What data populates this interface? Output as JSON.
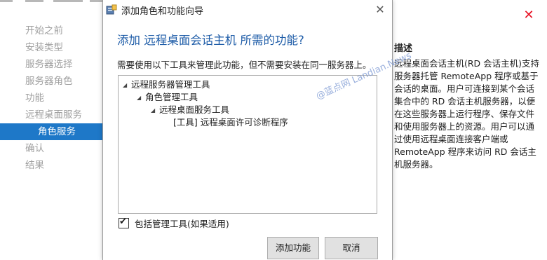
{
  "background_wizard": {
    "close_icon": "close-icon",
    "nav_items": [
      {
        "label": "开始之前"
      },
      {
        "label": "安装类型"
      },
      {
        "label": "服务器选择"
      },
      {
        "label": "服务器角色"
      },
      {
        "label": "功能"
      },
      {
        "label": "远程桌面服务"
      },
      {
        "label": "角色服务"
      },
      {
        "label": "确认"
      },
      {
        "label": "结果"
      }
    ],
    "active_nav_index": 6,
    "description_title": "描述",
    "description_text": "远程桌面会话主机(RD 会话主机)支持服务器托管 RemoteApp 程序或基于会话的桌面。用户可连接到某个会话集合中的 RD 会话主机服务器，以便在这些服务器上运行程序、保存文件和使用服务器上的资源。用户可以通过使用远程桌面连接客户端或 RemoteApp 程序来访问 RD 会话主机服务器。"
  },
  "dialog": {
    "title": "添加角色和功能向导",
    "heading": "添加 远程桌面会话主机 所需的功能?",
    "instruction": "需要使用以下工具来管理此功能，但不需要安装在同一服务器上。",
    "tree": [
      {
        "label": "远程服务器管理工具"
      },
      {
        "label": "角色管理工具"
      },
      {
        "label": "远程桌面服务工具"
      },
      {
        "label": "[工具] 远程桌面许可诊断程序"
      }
    ],
    "include_tools_checked": true,
    "include_tools_label": "包括管理工具(如果适用)",
    "add_button": "添加功能",
    "cancel_button": "取消"
  },
  "watermark": "@蓝点网 Landian.News",
  "colors": {
    "accent": "#1e78c8",
    "heading": "#1f5da8",
    "close_red": "#e81123"
  }
}
